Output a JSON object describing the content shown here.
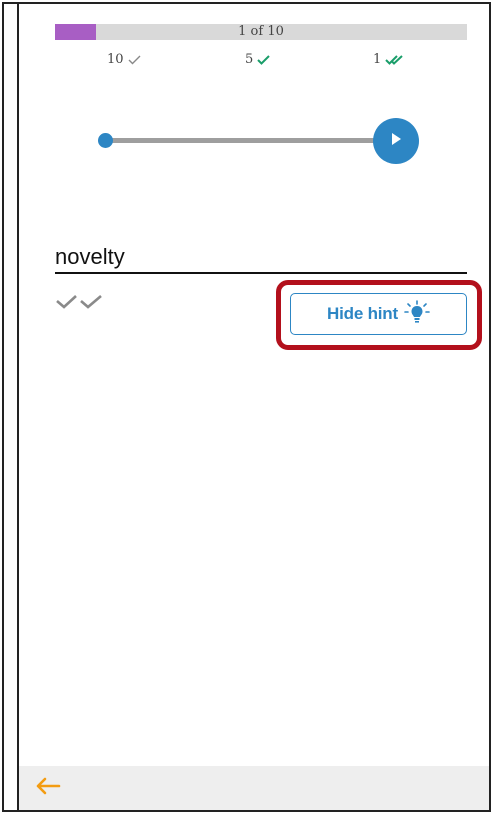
{
  "progress": {
    "label": "1 of 10",
    "fraction": 0.1,
    "fill_color": "#a85ec4"
  },
  "stats": [
    {
      "count": "10",
      "icon": "check-icon",
      "color": "#888888"
    },
    {
      "count": "5",
      "icon": "check-icon",
      "color": "#1a9e6a"
    },
    {
      "count": "1",
      "icon": "double-check-icon",
      "color": "#1a9e6a"
    }
  ],
  "audio_player": {
    "position_fraction": 0.0,
    "play_icon": "play-icon",
    "accent_color": "#2d86c4"
  },
  "answer": {
    "word": "novelty",
    "status_icon": "double-check-icon"
  },
  "hint_button": {
    "label": "Hide hint",
    "icon": "lightbulb-icon"
  },
  "bottom_bar": {
    "back_icon": "arrow-left-icon",
    "back_color": "#f39c12"
  }
}
